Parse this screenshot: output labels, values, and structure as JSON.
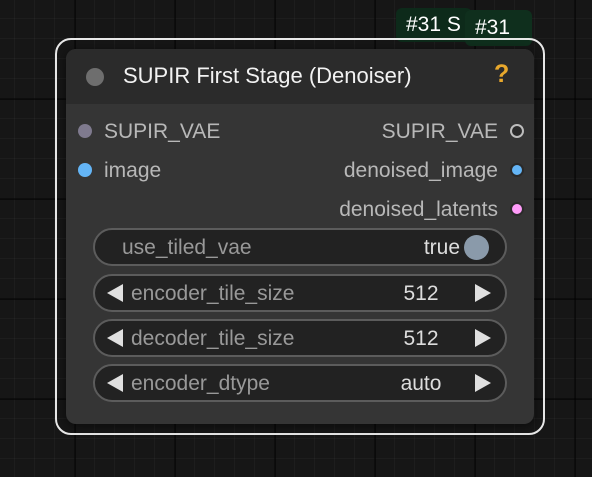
{
  "badges": {
    "back_text": "#31 S",
    "front_text": "#31"
  },
  "node": {
    "title": "SUPIR First Stage (Denoiser)",
    "help_glyph": "?",
    "inputs": [
      {
        "label": "SUPIR_VAE",
        "color": "#7f7a8e"
      },
      {
        "label": "image",
        "color": "#64b5f6"
      }
    ],
    "outputs": [
      {
        "label": "SUPIR_VAE",
        "color": "#2a2a2a"
      },
      {
        "label": "denoised_image",
        "color": "#64b5f6"
      },
      {
        "label": "denoised_latents",
        "color": "#ff9cf9"
      }
    ],
    "widgets": {
      "use_tiled_vae": {
        "label": "use_tiled_vae",
        "value": "true"
      },
      "encoder_tile_size": {
        "label": "encoder_tile_size",
        "value": "512"
      },
      "decoder_tile_size": {
        "label": "decoder_tile_size",
        "value": "512"
      },
      "encoder_dtype": {
        "label": "encoder_dtype",
        "value": "auto"
      }
    }
  },
  "colors": {
    "help": "#e8a82c",
    "badge_bg": "#0d2a1a"
  }
}
